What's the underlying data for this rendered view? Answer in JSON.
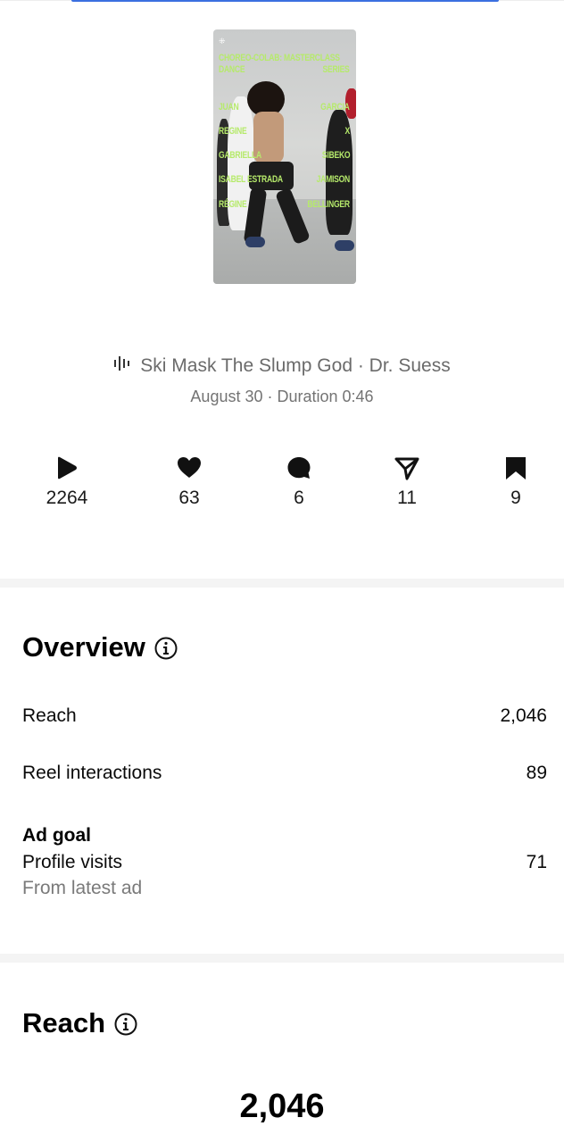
{
  "thumbnail": {
    "logo": "⁜",
    "overlay_lines": [
      {
        "left": "CHOREO-COLAB: MASTERCLASS",
        "right": ""
      },
      {
        "left": "DANCE",
        "right": "SERIES"
      },
      {
        "left": "JUAN",
        "right": "GARCIA"
      },
      {
        "left": "REGINE",
        "right": "X"
      },
      {
        "left": "GABRIELLA",
        "right": "SIBEKO"
      },
      {
        "left": "ISABEL ESTRADA",
        "right": "JAMISON"
      },
      {
        "left": "RÉGINE",
        "right": "BELLINGER"
      }
    ]
  },
  "audio": {
    "icon": "audio-waveform-icon",
    "label": "Ski Mask The Slump God · Dr. Suess"
  },
  "meta": {
    "text": "August 30 · Duration 0:46"
  },
  "stats": [
    {
      "icon": "play-icon",
      "value": "2264"
    },
    {
      "icon": "heart-icon",
      "value": "63"
    },
    {
      "icon": "comment-icon",
      "value": "6"
    },
    {
      "icon": "share-icon",
      "value": "11"
    },
    {
      "icon": "bookmark-icon",
      "value": "9"
    }
  ],
  "overview": {
    "title": "Overview",
    "info_icon": "info-icon",
    "reach_label": "Reach",
    "reach_value": "2,046",
    "interactions_label": "Reel interactions",
    "interactions_value": "89",
    "ad_goal_title": "Ad goal",
    "ad_goal_label": "Profile visits",
    "ad_goal_value": "71",
    "ad_goal_sub": "From latest ad"
  },
  "reach": {
    "title": "Reach",
    "info_icon": "info-icon",
    "total": "2,046"
  },
  "colors": {
    "overlay_text": "#b6ea6b",
    "accent_strip": "#3b6fe0",
    "muted_text": "#737373"
  }
}
